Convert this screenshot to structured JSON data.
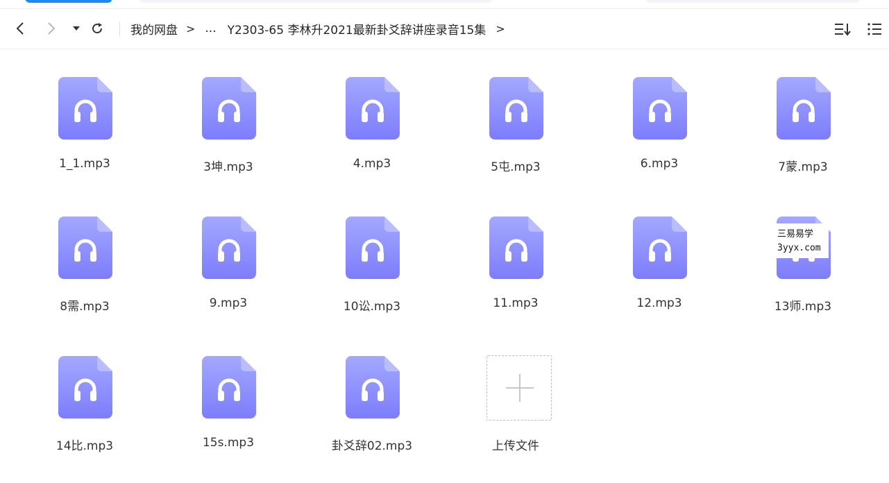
{
  "toolbar": {
    "breadcrumb_root": "我的网盘",
    "breadcrumb_sep": ">",
    "breadcrumb_ellipsis": "...",
    "breadcrumb_current": "Y2303-65 李林升2021最新卦爻辞讲座录音15集",
    "breadcrumb_trailing_sep": ">"
  },
  "files": [
    {
      "name": "1_1.mp3"
    },
    {
      "name": "3坤.mp3"
    },
    {
      "name": "4.mp3"
    },
    {
      "name": "5屯.mp3"
    },
    {
      "name": "6.mp3"
    },
    {
      "name": "7蒙.mp3"
    },
    {
      "name": "8需.mp3"
    },
    {
      "name": "9.mp3"
    },
    {
      "name": "10讼.mp3"
    },
    {
      "name": "11.mp3"
    },
    {
      "name": "12.mp3"
    },
    {
      "name": "13师.mp3"
    },
    {
      "name": "14比.mp3"
    },
    {
      "name": "15s.mp3"
    },
    {
      "name": "卦爻辞02.mp3"
    }
  ],
  "upload": {
    "label": "上传文件"
  },
  "watermark": {
    "line1": "三易易学",
    "line2": "3yyx.com"
  },
  "colors": {
    "icon_gradient_top": "#a3a8ff",
    "icon_gradient_bottom": "#7d7dfc",
    "accent": "#1e88f7"
  }
}
